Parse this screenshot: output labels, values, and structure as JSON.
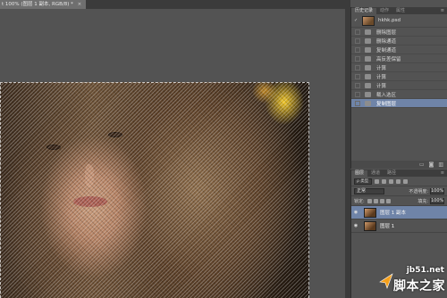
{
  "document": {
    "tab_title": "t 100% (图层 1 副本, RGB/8) *",
    "close_glyph": "×"
  },
  "history_panel": {
    "tabs": [
      "历史记录",
      "动作",
      "属性"
    ],
    "menu_glyph": "≡",
    "snapshot": {
      "check": "✓",
      "name": "hkhk.psd"
    },
    "items": [
      {
        "label": "删除图层",
        "selected": false
      },
      {
        "label": "删除通道",
        "selected": false
      },
      {
        "label": "复制通道",
        "selected": false
      },
      {
        "label": "高反差保留",
        "selected": false
      },
      {
        "label": "计算",
        "selected": false
      },
      {
        "label": "计算",
        "selected": false
      },
      {
        "label": "计算",
        "selected": false
      },
      {
        "label": "载入选区",
        "selected": false
      },
      {
        "label": "复制图层",
        "selected": true
      }
    ],
    "footer_icons": [
      "new-doc-from-state-icon",
      "camera-icon",
      "trash-icon"
    ]
  },
  "layers_panel": {
    "tabs": [
      "图层",
      "通道",
      "路径"
    ],
    "menu_glyph": "≡",
    "kind_label": "ρ 类型",
    "blend_mode": "正常",
    "opacity_label": "不透明度:",
    "opacity_value": "100%",
    "lock_label": "锁定:",
    "fill_label": "填充:",
    "fill_value": "100%",
    "layers": [
      {
        "name": "图层 1 副本",
        "selected": true,
        "visible": true
      },
      {
        "name": "图层 1",
        "selected": false,
        "visible": true
      }
    ]
  },
  "watermark": {
    "url": "jb51.net",
    "name": "脚本之家"
  },
  "colors": {
    "selection_highlight": "#6f84a8",
    "panel_bg": "#535353",
    "dark_bar": "#3b3b3b"
  }
}
